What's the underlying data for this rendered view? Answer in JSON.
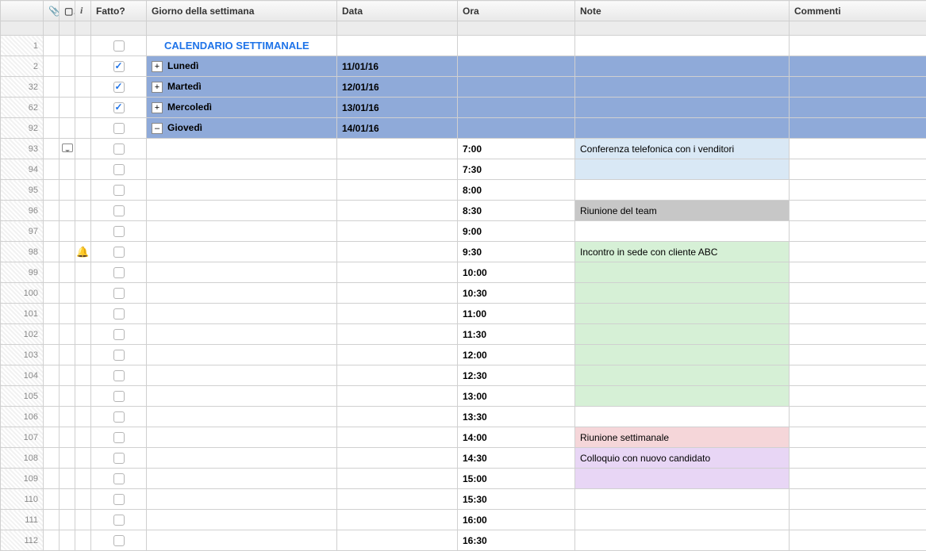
{
  "columns": {
    "rownum": "",
    "attach": "",
    "comment": "",
    "info": "i",
    "fatto": "Fatto?",
    "giorno": "Giorno della settimana",
    "data": "Data",
    "ora": "Ora",
    "note": "Note",
    "commenti": "Commenti"
  },
  "title_row": {
    "num": "1",
    "label": "CALENDARIO SETTIMANALE"
  },
  "day_rows": [
    {
      "num": "2",
      "expand": "+",
      "label": "Lunedì",
      "date": "11/01/16",
      "checked": true
    },
    {
      "num": "32",
      "expand": "+",
      "label": "Martedì",
      "date": "12/01/16",
      "checked": true
    },
    {
      "num": "62",
      "expand": "+",
      "label": "Mercoledì",
      "date": "13/01/16",
      "checked": true
    },
    {
      "num": "92",
      "expand": "–",
      "label": "Giovedì",
      "date": "14/01/16",
      "checked": false
    }
  ],
  "time_rows": [
    {
      "num": "93",
      "ora": "7:00",
      "note": "Conferenza telefonica con i venditori",
      "note_class": "note-lightblue",
      "icon": "comment"
    },
    {
      "num": "94",
      "ora": "7:30",
      "note": "",
      "note_class": "note-lightblue"
    },
    {
      "num": "95",
      "ora": "8:00",
      "note": "",
      "note_class": ""
    },
    {
      "num": "96",
      "ora": "8:30",
      "note": "Riunione del team",
      "note_class": "note-gray"
    },
    {
      "num": "97",
      "ora": "9:00",
      "note": "",
      "note_class": ""
    },
    {
      "num": "98",
      "ora": "9:30",
      "note": "Incontro in sede con cliente ABC",
      "note_class": "note-green",
      "icon": "bell"
    },
    {
      "num": "99",
      "ora": "10:00",
      "note": "",
      "note_class": "note-green"
    },
    {
      "num": "100",
      "ora": "10:30",
      "note": "",
      "note_class": "note-green"
    },
    {
      "num": "101",
      "ora": "11:00",
      "note": "",
      "note_class": "note-green"
    },
    {
      "num": "102",
      "ora": "11:30",
      "note": "",
      "note_class": "note-green"
    },
    {
      "num": "103",
      "ora": "12:00",
      "note": "",
      "note_class": "note-green"
    },
    {
      "num": "104",
      "ora": "12:30",
      "note": "",
      "note_class": "note-green"
    },
    {
      "num": "105",
      "ora": "13:00",
      "note": "",
      "note_class": "note-green"
    },
    {
      "num": "106",
      "ora": "13:30",
      "note": "",
      "note_class": ""
    },
    {
      "num": "107",
      "ora": "14:00",
      "note": "Riunione settimanale",
      "note_class": "note-pink"
    },
    {
      "num": "108",
      "ora": "14:30",
      "note": "Colloquio con nuovo candidato",
      "note_class": "note-purple"
    },
    {
      "num": "109",
      "ora": "15:00",
      "note": "",
      "note_class": "note-purple"
    },
    {
      "num": "110",
      "ora": "15:30",
      "note": "",
      "note_class": ""
    },
    {
      "num": "111",
      "ora": "16:00",
      "note": "",
      "note_class": ""
    },
    {
      "num": "112",
      "ora": "16:30",
      "note": "",
      "note_class": ""
    }
  ]
}
